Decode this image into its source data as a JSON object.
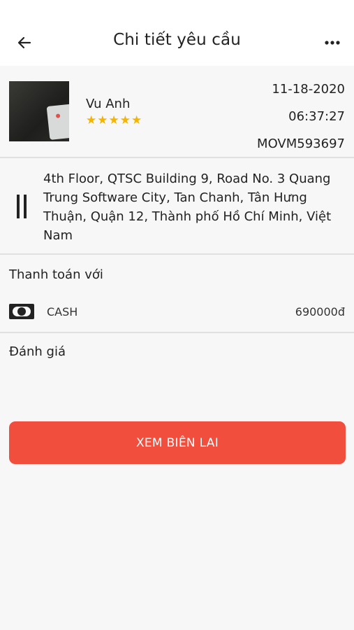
{
  "header": {
    "title": "Chi tiết yêu cầu",
    "back_icon": "arrow-left-icon",
    "more_icon": "more-horizontal-icon"
  },
  "order": {
    "driver_name": "Vu Anh",
    "rating": "★★★★★",
    "date": "11-18-2020",
    "time": "06:37:27",
    "code": "MOVM593697"
  },
  "address": {
    "text": "4th Floor, QTSC Building 9, Road No. 3 Quang Trung Software City, Tan Chanh, Tân Hưng Thuận, Quận 12, Thành phố Hồ Chí Minh, Việt Nam",
    "icon": "route-icon"
  },
  "payment": {
    "label": "Thanh toán với",
    "method": "CASH",
    "method_icon": "cash-icon",
    "amount": "690000đ"
  },
  "review": {
    "label": "Đánh giá"
  },
  "actions": {
    "receipt_label": "XEM BIÊN LAI"
  },
  "colors": {
    "accent": "#f24e3e",
    "star": "#f5b400",
    "background": "#f7f7f7"
  }
}
